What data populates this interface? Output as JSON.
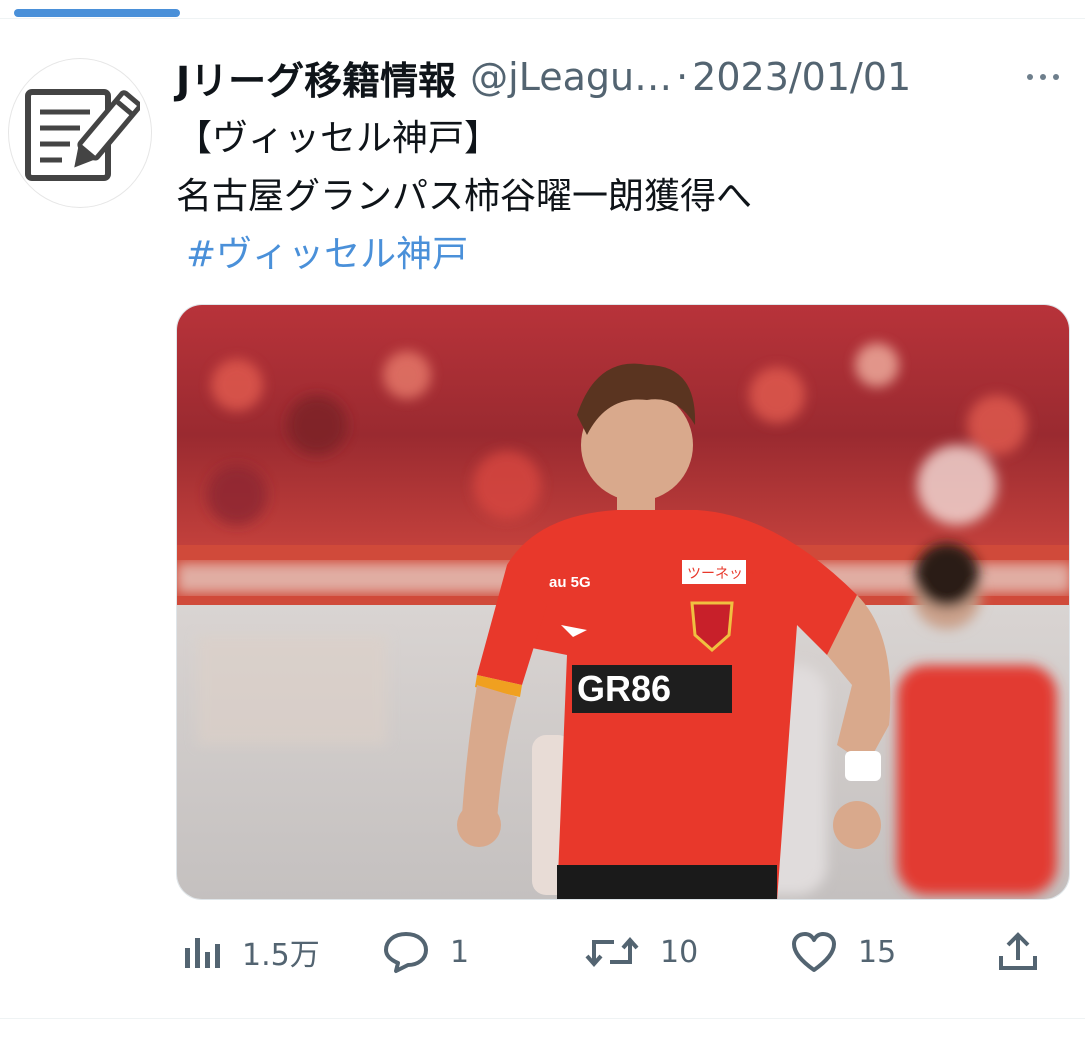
{
  "tweet": {
    "display_name": "Jリーグ移籍情報",
    "handle": "@jLeagu…",
    "separator": "·",
    "date": "2023/01/01",
    "text_lines": [
      "【ヴィッセル神戸】",
      "名古屋グランパス柿谷曜一朗獲得へ"
    ],
    "hashtag": "#ヴィッセル神戸",
    "media": {
      "shirt_sponsor": "GR86",
      "sleeve_logo": "au 5G",
      "patch_text": "ツーネット"
    }
  },
  "actions": {
    "views": {
      "icon": "views-bar-chart-icon",
      "count": "1.5万"
    },
    "replies": {
      "icon": "reply-bubble-icon",
      "count": "1"
    },
    "retweets": {
      "icon": "retweet-icon",
      "count": "10"
    },
    "likes": {
      "icon": "heart-icon",
      "count": "15"
    },
    "share": {
      "icon": "share-upload-icon"
    }
  },
  "colors": {
    "link": "#4a90d9",
    "muted": "#536471",
    "jersey": "#e8382b"
  }
}
